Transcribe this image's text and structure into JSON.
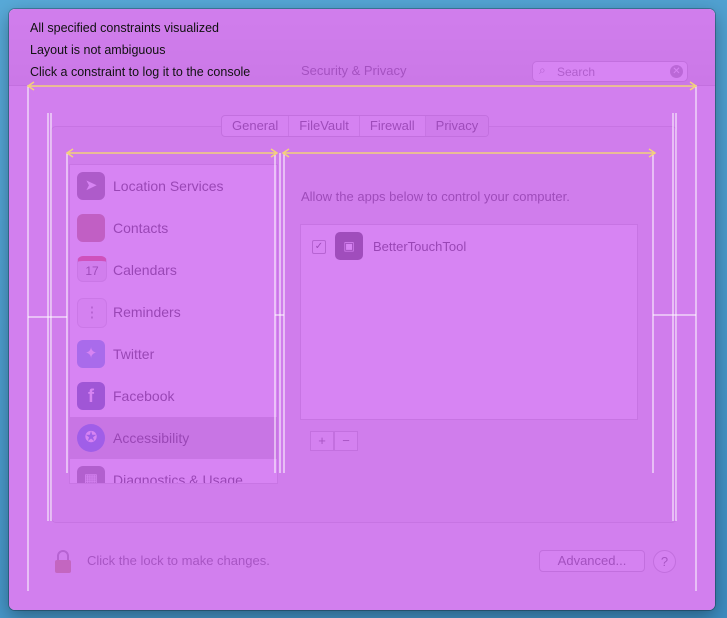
{
  "window": {
    "title": "Security & Privacy"
  },
  "search": {
    "placeholder": "Search",
    "value": ""
  },
  "tabs": [
    {
      "label": "General",
      "active": false
    },
    {
      "label": "FileVault",
      "active": false
    },
    {
      "label": "Firewall",
      "active": false
    },
    {
      "label": "Privacy",
      "active": true
    }
  ],
  "sidebar": {
    "items": [
      {
        "label": "Location Services",
        "icon": "location-arrow-icon",
        "color": "#6d6d6d",
        "glyph": "➤"
      },
      {
        "label": "Contacts",
        "icon": "contacts-book-icon",
        "color": "#b07a56",
        "glyph": ""
      },
      {
        "label": "Calendars",
        "icon": "calendar-icon",
        "color": "#e9e9e9",
        "glyph": "17"
      },
      {
        "label": "Reminders",
        "icon": "reminders-icon",
        "color": "#f4f4f4",
        "glyph": "⋮"
      },
      {
        "label": "Twitter",
        "icon": "twitter-bird-icon",
        "color": "#59a7e0",
        "glyph": "✦"
      },
      {
        "label": "Facebook",
        "icon": "facebook-icon",
        "color": "#3b5998",
        "glyph": "f"
      },
      {
        "label": "Accessibility",
        "icon": "accessibility-person-icon",
        "color": "#3a76d8",
        "glyph": "✪",
        "selected": true
      },
      {
        "label": "Diagnostics & Usage",
        "icon": "diagnostics-icon",
        "color": "#7a7a7a",
        "glyph": "▦"
      }
    ]
  },
  "main": {
    "allow_text": "Allow the apps below to control your computer.",
    "apps": [
      {
        "name": "BetterTouchTool",
        "checked": true,
        "icon": "bettertouchtool-icon",
        "glyph": "▣"
      }
    ],
    "add_label": "+",
    "remove_label": "−"
  },
  "footer": {
    "lock_text": "Click the lock to make changes.",
    "advanced_label": "Advanced...",
    "help_label": "?"
  },
  "overlay": {
    "messages": [
      "All specified constraints visualized",
      "Layout is not ambiguous",
      "Click a constraint to log it to the console"
    ],
    "tint_color": "#c854ee",
    "line_color": "#ffffff",
    "hline_color": "#f3d27a"
  }
}
